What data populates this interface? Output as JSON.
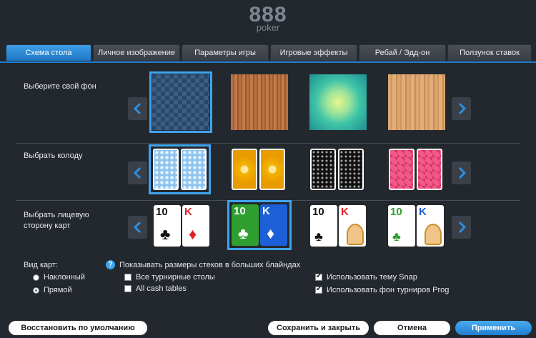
{
  "logo": {
    "top": "888",
    "bottom": "poker"
  },
  "tabs": [
    "Схема стола",
    "Личное изображение",
    "Параметры игры",
    "Игровые эффекты",
    "Ребай / Эдд-он",
    "Ползунок ставок"
  ],
  "rows": {
    "background_label": "Выберите свой фон",
    "deck_label": "Выбрать колоду",
    "faces_label": "Выбрать лицевую сторону карт"
  },
  "faces": {
    "rank_ten": "10",
    "rank_king": "K",
    "club": "♣",
    "diamond": "♦"
  },
  "card_view": {
    "label": "Вид карт:",
    "options": [
      "Наклонный",
      "Прямой"
    ],
    "selected": "Прямой"
  },
  "checkboxes": {
    "stack_bb": "Показывать размеры стеков в больших блайндах",
    "all_tournament": "Все турнирные столы",
    "all_cash": "All cash tables",
    "snap_theme": "Использовать тему Snap",
    "prog_bg": "Использовать фон турниров Prog"
  },
  "buttons": {
    "restore": "Восстановить по умолчанию",
    "save_close": "Сохранить и закрыть",
    "cancel": "Отмена",
    "apply": "Применить"
  },
  "colors": {
    "accent": "#1f7ed0",
    "background": "#23282e"
  }
}
